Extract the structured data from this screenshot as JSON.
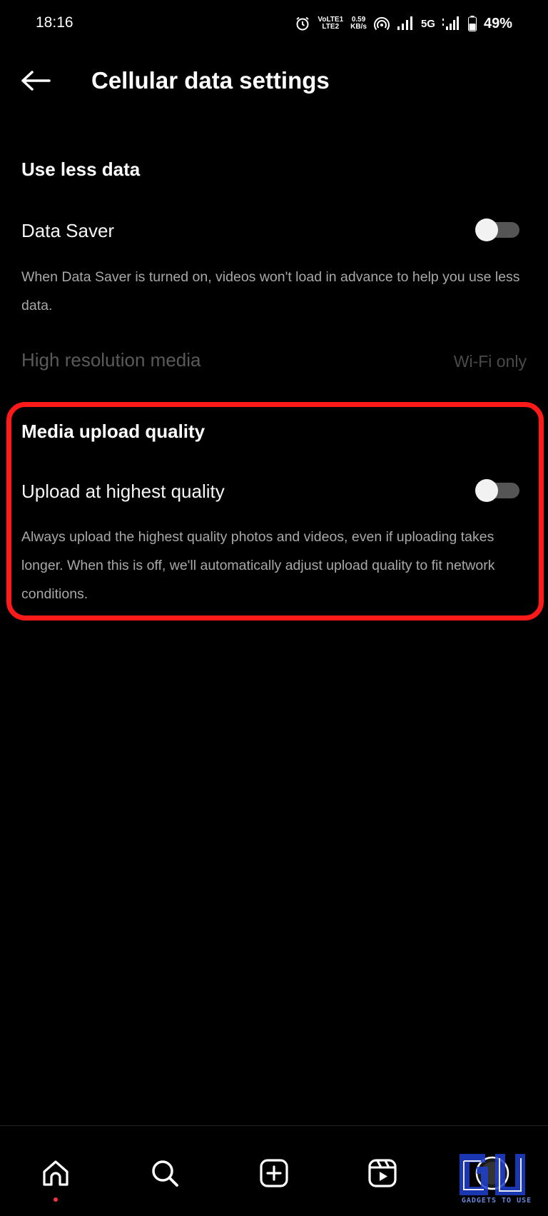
{
  "status_bar": {
    "time": "18:16",
    "volte": "VoLTE1",
    "lte": "LTE2",
    "speed_value": "0.59",
    "speed_unit": "KB/s",
    "network": "5G",
    "battery": "49%"
  },
  "header": {
    "title": "Cellular data settings"
  },
  "sections": {
    "use_less_data": {
      "title": "Use less data",
      "data_saver": {
        "label": "Data Saver",
        "enabled": false,
        "description": "When Data Saver is turned on, videos won't load in advance to help you use less data."
      },
      "high_res_media": {
        "label": "High resolution media",
        "value": "Wi-Fi only"
      }
    },
    "media_upload_quality": {
      "title": "Media upload quality",
      "upload_highest": {
        "label": "Upload at highest quality",
        "enabled": false,
        "description": "Always upload the highest quality photos and videos, even if uploading takes longer. When this is off, we'll automatically adjust upload quality to fit network conditions."
      }
    }
  },
  "highlight_color": "#ff1a1a",
  "bottom_nav": {
    "items": [
      "home-icon",
      "search-icon",
      "create-icon",
      "reels-icon",
      "profile-icon"
    ]
  },
  "watermark": {
    "text": "GADGETS TO USE"
  }
}
